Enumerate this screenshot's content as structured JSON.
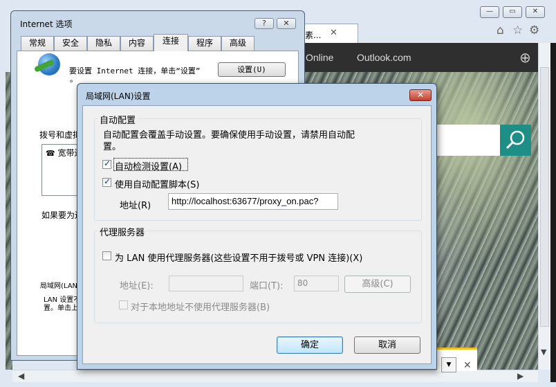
{
  "browser": {
    "tab_title": "素...",
    "tab_close": "✕",
    "nav_links": [
      "Online",
      "Outlook.com"
    ],
    "caption_buttons": [
      "minimize",
      "maximize",
      "close"
    ],
    "toolbar_icons": [
      "home-icon",
      "favorites-star-icon",
      "settings-gear-icon"
    ],
    "search_icon": "search-icon",
    "notification_close": "✕"
  },
  "internet_options": {
    "title": "Internet 选项",
    "help_button": "?",
    "close_button": "✕",
    "tabs": [
      "常规",
      "安全",
      "隐私",
      "内容",
      "连接",
      "程序",
      "高级"
    ],
    "active_tab": "连接",
    "setup_text": "要设置 Internet 连接，单击“设置”",
    "setup_dot": "。",
    "setup_button": "设置(U)",
    "dialup_label": "拨号和虚拟专",
    "dialup_item": "宽带连",
    "if_need_text": "如果要为连",
    "lan_label": "局域网(LAN)",
    "lan_desc_line1": "LAN 设置不",
    "lan_desc_line2": "置。单击上"
  },
  "lan_dialog": {
    "title": "局域网(LAN)设置",
    "close_button": "✕",
    "auto_config": {
      "group_title": "自动配置",
      "description_line1": "自动配置会覆盖手动设置。要确保使用手动设置，请禁用自动配",
      "description_line2": "置。",
      "auto_detect_label": "自动检测设置(A)",
      "auto_detect_checked": true,
      "use_script_label": "使用自动配置脚本(S)",
      "use_script_checked": true,
      "address_label": "地址(R)",
      "address_value": "http://localhost:63677/proxy_on.pac?"
    },
    "proxy_server": {
      "group_title": "代理服务器",
      "use_proxy_label": "为 LAN 使用代理服务器(这些设置不用于拨号或 VPN 连接)(X)",
      "use_proxy_checked": false,
      "address_label": "地址(E):",
      "address_value": "",
      "port_label": "端口(T):",
      "port_value": "80",
      "advanced_button": "高级(C)",
      "bypass_local_label": "对于本地地址不使用代理服务器(B)",
      "bypass_local_checked": false
    },
    "ok_button": "确定",
    "cancel_button": "取消"
  }
}
